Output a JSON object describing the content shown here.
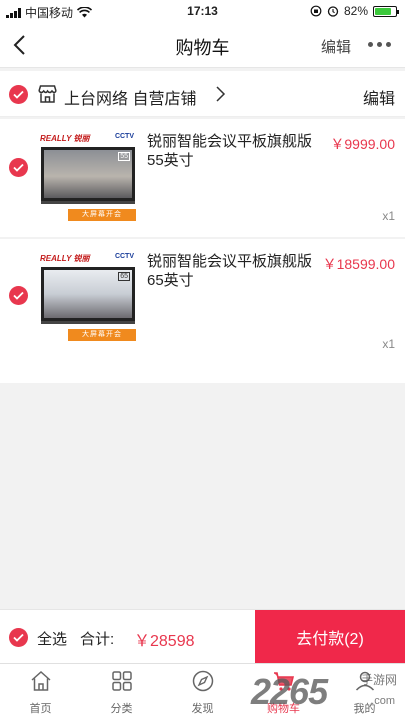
{
  "status_bar": {
    "carrier": "中国移动",
    "time": "17:13",
    "battery": "82%"
  },
  "nav": {
    "title": "购物车",
    "edit_label": "编辑"
  },
  "shop": {
    "name": "上台网络 自营店铺",
    "edit_label": "编辑"
  },
  "items": [
    {
      "name": "锐丽智能会议平板旗舰版55英寸",
      "price": "￥9999.00",
      "qty": "x1",
      "thumb_brand": "REALLY 锐丽",
      "thumb_partner": "CCTV",
      "thumb_size": "55",
      "thumb_banner": "大屏幕开会"
    },
    {
      "name": "锐丽智能会议平板旗舰版65英寸",
      "price": "￥18599.00",
      "qty": "x1",
      "thumb_brand": "REALLY 锐丽",
      "thumb_partner": "CCTV",
      "thumb_size": "65",
      "thumb_banner": "大屏幕开会"
    }
  ],
  "footer": {
    "select_all": "全选",
    "total_label": "合计:",
    "total_value": "￥28598",
    "pay_button": "去付款(2)"
  },
  "tabs": [
    {
      "label": "首页",
      "icon": "home-icon"
    },
    {
      "label": "分类",
      "icon": "category-icon"
    },
    {
      "label": "发现",
      "icon": "compass-icon"
    },
    {
      "label": "购物车",
      "icon": "cart-icon",
      "active": true
    },
    {
      "label": "我的",
      "icon": "user-icon"
    }
  ],
  "watermark": {
    "text": "2265",
    "suffix": ".com",
    "subtitle": "手游网"
  },
  "colors": {
    "accent": "#e8374e",
    "pay_button": "#f0284a",
    "battery": "#3cc93c"
  }
}
